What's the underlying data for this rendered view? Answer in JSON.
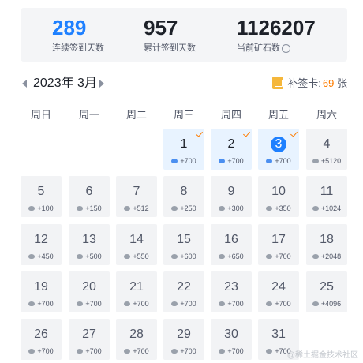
{
  "stats": [
    {
      "value": "289",
      "label": "连续签到天数",
      "color": "#1e80ff"
    },
    {
      "value": "957",
      "label": "累计签到天数",
      "color": "#1d2129"
    },
    {
      "value": "1126207",
      "label": "当前矿石数",
      "color": "#1d2129",
      "info_icon": "info-icon"
    }
  ],
  "month": {
    "title": "2023年 3月",
    "prev_icon": "chevron-left-icon",
    "next_icon": "chevron-right-icon"
  },
  "makeup_card": {
    "label": "补签卡:",
    "count": "69",
    "unit": "张",
    "icon": "card-icon"
  },
  "weekdays": [
    "周日",
    "周一",
    "周二",
    "周三",
    "周四",
    "周五",
    "周六"
  ],
  "days": [
    {
      "day": "1",
      "reward": "+700",
      "signed": true
    },
    {
      "day": "2",
      "reward": "+700",
      "signed": true
    },
    {
      "day": "3",
      "reward": "+700",
      "signed": true,
      "today": true
    },
    {
      "day": "4",
      "reward": "+5120",
      "signed": false
    },
    {
      "day": "5",
      "reward": "+100",
      "signed": false
    },
    {
      "day": "6",
      "reward": "+150",
      "signed": false
    },
    {
      "day": "7",
      "reward": "+512",
      "signed": false
    },
    {
      "day": "8",
      "reward": "+250",
      "signed": false
    },
    {
      "day": "9",
      "reward": "+300",
      "signed": false
    },
    {
      "day": "10",
      "reward": "+350",
      "signed": false
    },
    {
      "day": "11",
      "reward": "+1024",
      "signed": false
    },
    {
      "day": "12",
      "reward": "+450",
      "signed": false
    },
    {
      "day": "13",
      "reward": "+500",
      "signed": false
    },
    {
      "day": "14",
      "reward": "+550",
      "signed": false
    },
    {
      "day": "15",
      "reward": "+600",
      "signed": false
    },
    {
      "day": "16",
      "reward": "+650",
      "signed": false
    },
    {
      "day": "17",
      "reward": "+700",
      "signed": false
    },
    {
      "day": "18",
      "reward": "+2048",
      "signed": false
    },
    {
      "day": "19",
      "reward": "+700",
      "signed": false
    },
    {
      "day": "20",
      "reward": "+700",
      "signed": false
    },
    {
      "day": "21",
      "reward": "+700",
      "signed": false
    },
    {
      "day": "22",
      "reward": "+700",
      "signed": false
    },
    {
      "day": "23",
      "reward": "+700",
      "signed": false
    },
    {
      "day": "24",
      "reward": "+700",
      "signed": false
    },
    {
      "day": "25",
      "reward": "+4096",
      "signed": false
    },
    {
      "day": "26",
      "reward": "+700",
      "signed": false
    },
    {
      "day": "27",
      "reward": "+700",
      "signed": false
    },
    {
      "day": "28",
      "reward": "+700",
      "signed": false
    },
    {
      "day": "29",
      "reward": "+700",
      "signed": false
    },
    {
      "day": "30",
      "reward": "+700",
      "signed": false
    },
    {
      "day": "31",
      "reward": "+700",
      "signed": false
    }
  ],
  "watermark": "@稀土掘金技术社区",
  "colors": {
    "accent": "#1e80ff",
    "signed_bg": "#e8f3ff",
    "check": "#ff7d00",
    "card_count": "#ff7d00"
  }
}
